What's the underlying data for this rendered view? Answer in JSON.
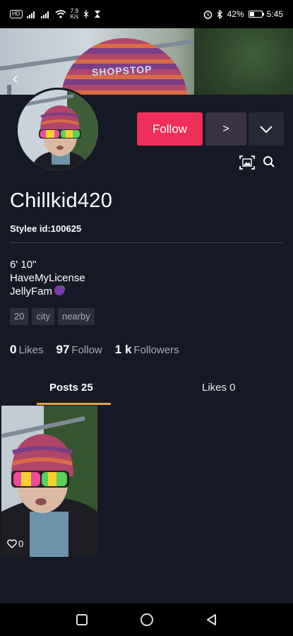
{
  "status_bar": {
    "left_icons": [
      "hd-icon",
      "signal-icon",
      "signal-icon",
      "wifi-icon"
    ],
    "speed_top": "7.9",
    "speed_unit": "K/s",
    "right_time": "5:45",
    "battery": "42%",
    "battery_level": 0.42
  },
  "profile": {
    "username": "Chillkid420",
    "stylee_id": "Stylee id:100625",
    "bio": [
      "6' 10\"",
      "HaveMyLicense",
      "JellyFam"
    ],
    "tags": [
      "20",
      "city",
      "nearby"
    ],
    "cover_hat_text": "SHOPSTOP"
  },
  "actions": {
    "follow_label": "Follow",
    "more_label": ">"
  },
  "stats": [
    {
      "value": "0",
      "label": "Likes"
    },
    {
      "value": "97",
      "label": "Follow"
    },
    {
      "value": "1 k",
      "label": "Followers"
    }
  ],
  "tabs": {
    "posts_label": "Posts 25",
    "likes_label": "Likes 0"
  },
  "posts": [
    {
      "likes": "0"
    }
  ],
  "colors": {
    "accent": "#f0305a",
    "tab_underline": "#e8a33a",
    "background": "#151926"
  }
}
